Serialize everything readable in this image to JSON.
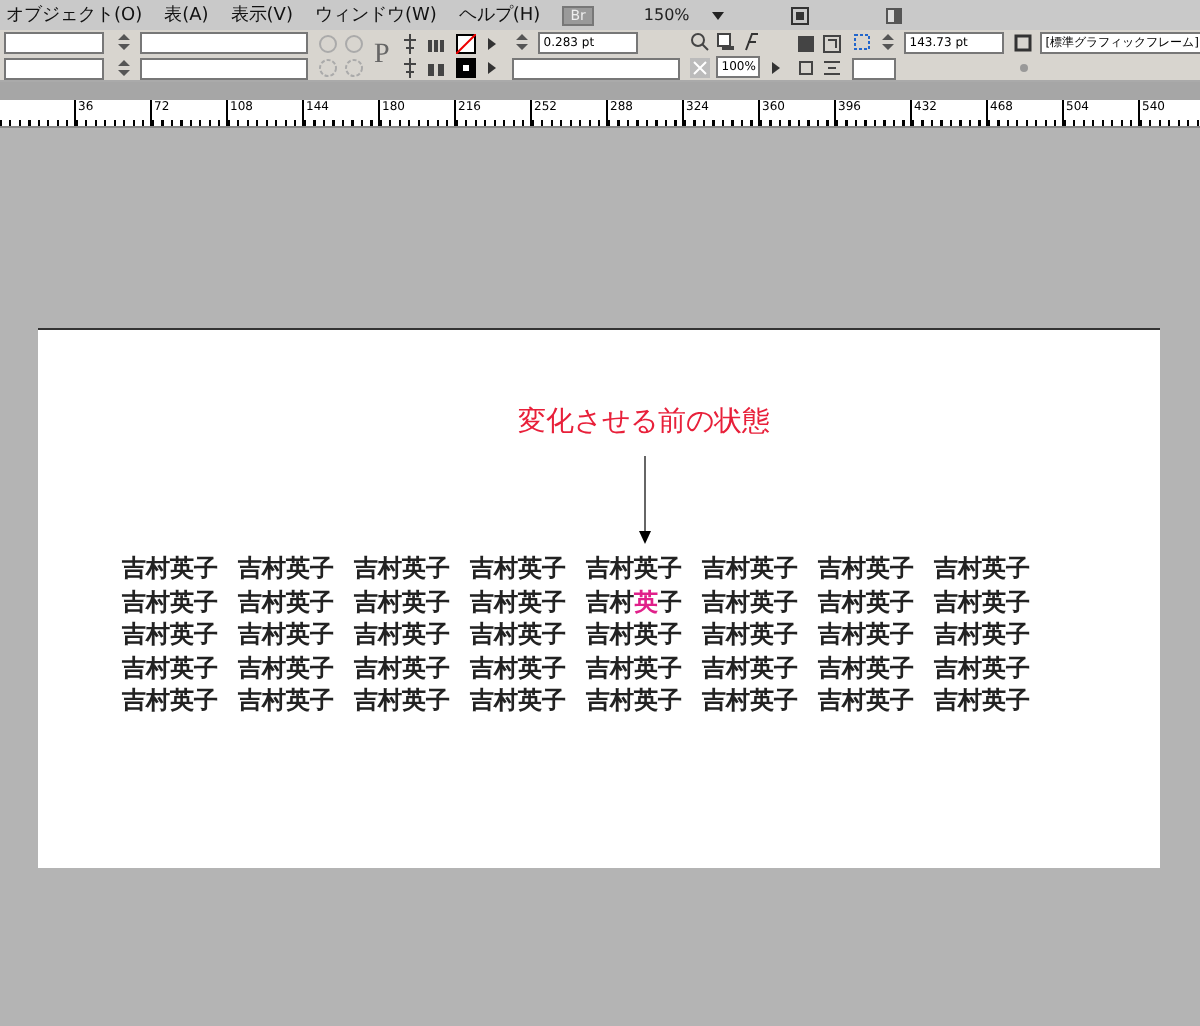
{
  "menu_bar": {
    "items": [
      "オブジェクト(O)",
      "表(A)",
      "表示(V)",
      "ウィンドウ(W)",
      "ヘルプ(H)"
    ],
    "bridge_button": "Br",
    "zoom": "150%"
  },
  "control_panel": {
    "paragraph_glyph": "P",
    "stroke_weight": "0.283 pt",
    "opacity": "100%",
    "dimension": "143.73 pt",
    "object_style": "[標準グラフィックフレーム]"
  },
  "ruler": {
    "labels": [
      "36",
      "72",
      "108",
      "144",
      "180",
      "216",
      "252",
      "288",
      "324",
      "360",
      "396",
      "432",
      "468",
      "504",
      "540"
    ]
  },
  "annotation": {
    "text": "変化させる前の状態"
  },
  "grid": {
    "rows": [
      [
        {
          "parts": [
            {
              "text": "吉村英子",
              "highlighted": false
            }
          ]
        },
        {
          "parts": [
            {
              "text": "吉村英子",
              "highlighted": false
            }
          ]
        },
        {
          "parts": [
            {
              "text": "吉村英子",
              "highlighted": false
            }
          ]
        },
        {
          "parts": [
            {
              "text": "吉村英子",
              "highlighted": false
            }
          ]
        },
        {
          "parts": [
            {
              "text": "吉村英子",
              "highlighted": false
            }
          ]
        },
        {
          "parts": [
            {
              "text": "吉村英子",
              "highlighted": false
            }
          ]
        },
        {
          "parts": [
            {
              "text": "吉村英子",
              "highlighted": false
            }
          ]
        },
        {
          "parts": [
            {
              "text": "吉村英子",
              "highlighted": false
            }
          ]
        }
      ],
      [
        {
          "parts": [
            {
              "text": "吉村英子",
              "highlighted": false
            }
          ]
        },
        {
          "parts": [
            {
              "text": "吉村英子",
              "highlighted": false
            }
          ]
        },
        {
          "parts": [
            {
              "text": "吉村英子",
              "highlighted": false
            }
          ]
        },
        {
          "parts": [
            {
              "text": "吉村英子",
              "highlighted": false
            }
          ]
        },
        {
          "parts": [
            {
              "text": "吉村",
              "highlighted": false
            },
            {
              "text": "英",
              "highlighted": true
            },
            {
              "text": "子",
              "highlighted": false
            }
          ]
        },
        {
          "parts": [
            {
              "text": "吉村英子",
              "highlighted": false
            }
          ]
        },
        {
          "parts": [
            {
              "text": "吉村英子",
              "highlighted": false
            }
          ]
        },
        {
          "parts": [
            {
              "text": "吉村英子",
              "highlighted": false
            }
          ]
        }
      ],
      [
        {
          "parts": [
            {
              "text": "吉村英子",
              "highlighted": false
            }
          ]
        },
        {
          "parts": [
            {
              "text": "吉村英子",
              "highlighted": false
            }
          ]
        },
        {
          "parts": [
            {
              "text": "吉村英子",
              "highlighted": false
            }
          ]
        },
        {
          "parts": [
            {
              "text": "吉村英子",
              "highlighted": false
            }
          ]
        },
        {
          "parts": [
            {
              "text": "吉村英子",
              "highlighted": false
            }
          ]
        },
        {
          "parts": [
            {
              "text": "吉村英子",
              "highlighted": false
            }
          ]
        },
        {
          "parts": [
            {
              "text": "吉村英子",
              "highlighted": false
            }
          ]
        },
        {
          "parts": [
            {
              "text": "吉村英子",
              "highlighted": false
            }
          ]
        }
      ],
      [
        {
          "parts": [
            {
              "text": "吉村英子",
              "highlighted": false
            }
          ]
        },
        {
          "parts": [
            {
              "text": "吉村英子",
              "highlighted": false
            }
          ]
        },
        {
          "parts": [
            {
              "text": "吉村英子",
              "highlighted": false
            }
          ]
        },
        {
          "parts": [
            {
              "text": "吉村英子",
              "highlighted": false
            }
          ]
        },
        {
          "parts": [
            {
              "text": "吉村英子",
              "highlighted": false
            }
          ]
        },
        {
          "parts": [
            {
              "text": "吉村英子",
              "highlighted": false
            }
          ]
        },
        {
          "parts": [
            {
              "text": "吉村英子",
              "highlighted": false
            }
          ]
        },
        {
          "parts": [
            {
              "text": "吉村英子",
              "highlighted": false
            }
          ]
        }
      ],
      [
        {
          "parts": [
            {
              "text": "吉村英子",
              "highlighted": false
            }
          ]
        },
        {
          "parts": [
            {
              "text": "吉村英子",
              "highlighted": false
            }
          ]
        },
        {
          "parts": [
            {
              "text": "吉村英子",
              "highlighted": false
            }
          ]
        },
        {
          "parts": [
            {
              "text": "吉村英子",
              "highlighted": false
            }
          ]
        },
        {
          "parts": [
            {
              "text": "吉村英子",
              "highlighted": false
            }
          ]
        },
        {
          "parts": [
            {
              "text": "吉村英子",
              "highlighted": false
            }
          ]
        },
        {
          "parts": [
            {
              "text": "吉村英子",
              "highlighted": false
            }
          ]
        },
        {
          "parts": [
            {
              "text": "吉村英子",
              "highlighted": false
            }
          ]
        }
      ]
    ]
  }
}
